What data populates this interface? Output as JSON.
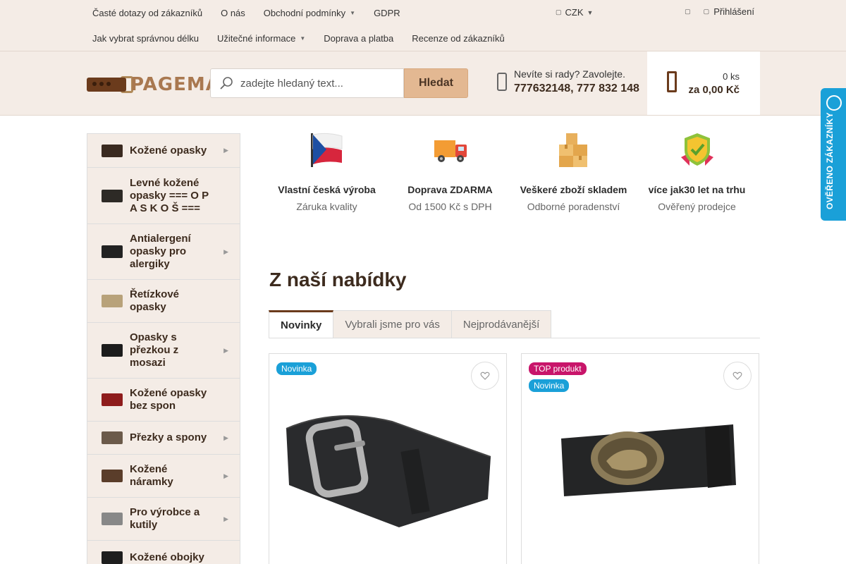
{
  "topbar": {
    "row1": [
      {
        "label": "Časté dotazy od zákazníků",
        "caret": false
      },
      {
        "label": "O nás",
        "caret": false
      },
      {
        "label": "Obchodní podmínky",
        "caret": true
      },
      {
        "label": "GDPR",
        "caret": false
      }
    ],
    "row2": [
      {
        "label": "Jak vybrat správnou délku",
        "caret": false
      },
      {
        "label": "Užitečné informace",
        "caret": true
      },
      {
        "label": "Doprava a platba",
        "caret": false
      },
      {
        "label": "Recenze od zákazníků",
        "caret": false
      }
    ],
    "currency": "CZK",
    "login": "Přihlášení"
  },
  "header": {
    "logo_text": "PAGEMA",
    "search_placeholder": "zadejte hledaný text...",
    "search_button": "Hledat",
    "contact_line1": "Nevíte si rady? Zavolejte.",
    "contact_phones": "777632148, 777 832 148",
    "cart_qty": "0 ks",
    "cart_sum": "za 0,00 Kč"
  },
  "categories": [
    {
      "label": "Kožené opasky",
      "arrow": true,
      "thumb": "#3a2a20"
    },
    {
      "label": "Levné kožené opasky === O P A S K O Š ===",
      "arrow": false,
      "thumb": "#2d2a26"
    },
    {
      "label": "Antialergení opasky pro alergiky",
      "arrow": true,
      "thumb": "#222222"
    },
    {
      "label": "Řetízkové opasky",
      "arrow": false,
      "thumb": "#b8a27a"
    },
    {
      "label": "Opasky s přezkou z mosazi",
      "arrow": true,
      "thumb": "#1c1c1c"
    },
    {
      "label": "Kožené opasky bez spon",
      "arrow": false,
      "thumb": "#8e1c1c"
    },
    {
      "label": "Přezky a spony",
      "arrow": true,
      "thumb": "#6b5a4a"
    },
    {
      "label": "Kožené náramky",
      "arrow": true,
      "thumb": "#5a3d2a"
    },
    {
      "label": "Pro výrobce a kutily",
      "arrow": true,
      "thumb": "#888888"
    },
    {
      "label": "Kožené obojky",
      "arrow": false,
      "thumb": "#1e1e1e"
    }
  ],
  "benefits": [
    {
      "title": "Vlastní česká výroba",
      "subtitle": "Záruka kvality",
      "icon": "czech-flag-icon"
    },
    {
      "title": "Doprava ZDARMA",
      "subtitle": "Od 1500 Kč s DPH",
      "icon": "delivery-truck-icon"
    },
    {
      "title": "Veškeré zboží skladem",
      "subtitle": "Odborné poradenství",
      "icon": "boxes-icon"
    },
    {
      "title": "více jak30 let na trhu",
      "subtitle": "Ověřený prodejce",
      "icon": "verified-shield-icon"
    }
  ],
  "section_title": "Z naší nabídky",
  "tabs": [
    "Novinky",
    "Vybrali jsme pro vás",
    "Nejprodávanější"
  ],
  "products": [
    {
      "flags": [
        {
          "label": "Novinka",
          "type": "new"
        }
      ],
      "image": "black-belt-silver-buckle"
    },
    {
      "flags": [
        {
          "label": "TOP produkt",
          "type": "top"
        },
        {
          "label": "Novinka",
          "type": "new"
        }
      ],
      "image": "black-belt-brass-buckle"
    }
  ],
  "badge_text": "OVĚŘENO ZÁKAZNÍKY",
  "colors": {
    "brand_brown": "#6b3b1c",
    "beige": "#f4ece6",
    "accent": "#e3b892",
    "flag_new": "#1aa0d8",
    "flag_top": "#c8156a"
  }
}
